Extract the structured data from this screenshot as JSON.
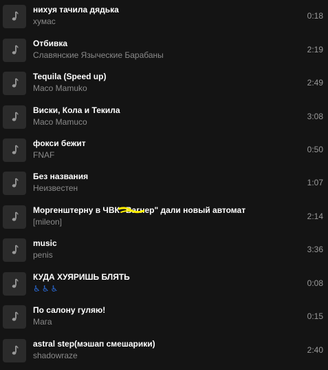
{
  "tracks": [
    {
      "title": "нихуя тачила дядька",
      "artist": "хумас",
      "duration": "0:18"
    },
    {
      "title": "Отбивка",
      "artist": "Славянские Языческие Барабаны",
      "duration": "2:19"
    },
    {
      "title": "Tequila (Speed up)",
      "artist": "Maco Mamuko",
      "duration": "2:49"
    },
    {
      "title": "Виски, Кола и Текила",
      "artist": "Maco Mamuco",
      "duration": "3:08"
    },
    {
      "title": "фокси бежит",
      "artist": "FNAF",
      "duration": "0:50"
    },
    {
      "title": "Без названия",
      "artist": "Неизвестен",
      "duration": "1:07"
    },
    {
      "title": "Моргенштерну в ЧВК \"Вагнер\" дали новый автомат",
      "artist": "[mileon]",
      "duration": "2:14"
    },
    {
      "title": "music",
      "artist": "penis",
      "duration": "3:36"
    },
    {
      "title": "КУДА ХУЯРИШЬ БЛЯТЬ",
      "artist": "♿♿♿",
      "duration": "0:08"
    },
    {
      "title": "По салону гуляю!",
      "artist": "Мага",
      "duration": "0:15"
    },
    {
      "title": "astral step(мэшап смешарики)",
      "artist": "shadowraze",
      "duration": "2:40"
    }
  ],
  "colors": {
    "background": "#141414",
    "cover": "#2b2b2b",
    "title": "#ffffff",
    "artist": "#8a8a8a",
    "duration": "#9a9a9a",
    "highlight": "#ffee00"
  },
  "icons": {
    "cover": "music-note-icon",
    "emoji": "wheelchair-icon"
  }
}
